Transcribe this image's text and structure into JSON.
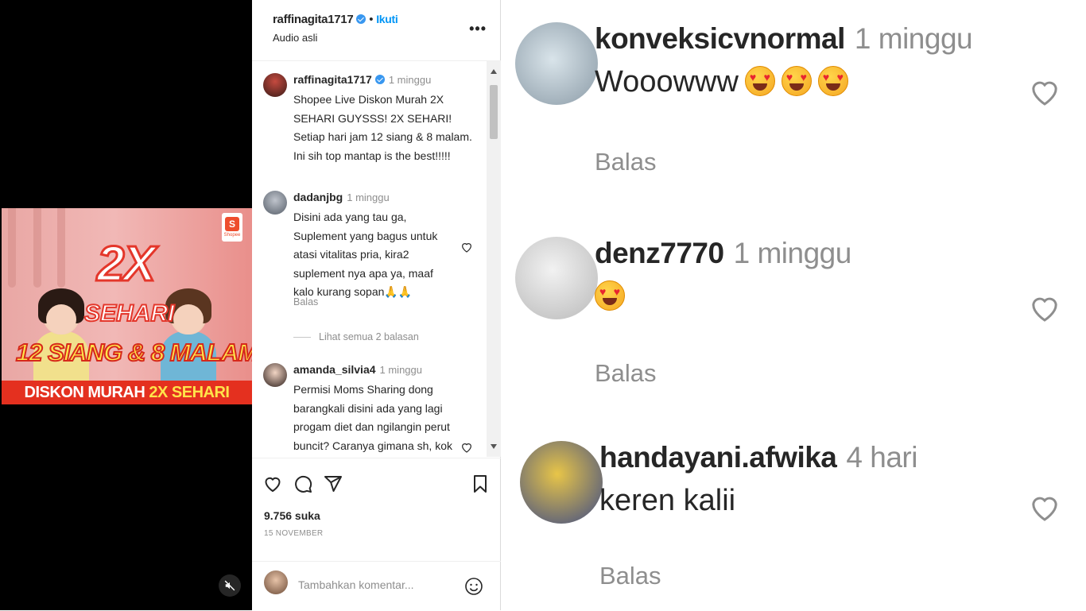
{
  "post": {
    "author": "raffinagita1717",
    "follow_label": "Ikuti",
    "audio_label": "Audio asli",
    "more_icon": "more-options-icon"
  },
  "video": {
    "thumbnail_text": {
      "main": "2X",
      "sub": "SEHARI",
      "times": "12 SIANG & 8 MALAM",
      "banner_prefix": "DISKON MURAH",
      "banner_highlight": "2X SEHARI",
      "brand_letter": "S",
      "brand_name": "Shopee"
    },
    "mute_icon": "muted-speaker-icon"
  },
  "caption": {
    "user": "raffinagita1717",
    "time": "1 minggu",
    "text": "Shopee Live Diskon Murah 2X SEHARI GUYSSS! 2X SEHARI! Setiap hari jam 12 siang & 8 malam. Ini sih top mantap is the best!!!!!"
  },
  "comments": [
    {
      "user": "dadanjbg",
      "time": "1 minggu",
      "text": "Disini ada yang tau ga, Suplement yang bagus untuk atasi vitalitas pria, kira2 suplement nya apa ya, maaf kalo kurang sopan🙏🙏",
      "reply_label": "Balas",
      "view_replies": "Lihat semua 2 balasan"
    },
    {
      "user": "amanda_silvia4",
      "time": "1 minggu",
      "text": "Permisi Moms Sharing dong barangkali disini ada yang lagi progam diet dan ngilangin perut buncit? Caranya gimana sh, kok"
    }
  ],
  "actions": {
    "likes": "9.756 suka",
    "date": "15 NOVEMBER",
    "comment_placeholder": "Tambahkan komentar..."
  },
  "zoomed_comments": [
    {
      "user": "konveksicvnormal",
      "time": "1 minggu",
      "text": "Wooowww",
      "emoji_count": 3,
      "reply_label": "Balas"
    },
    {
      "user": "denz7770",
      "time": "1 minggu",
      "text": "",
      "emoji_count": 1,
      "reply_label": "Balas"
    },
    {
      "user": "handayani.afwika",
      "time": "4 hari",
      "text": "keren kalii",
      "emoji_count": 0,
      "reply_label": "Balas"
    }
  ],
  "colors": {
    "link_blue": "#0095f6",
    "text_primary": "#262626",
    "text_secondary": "#8e8e8e",
    "verified": "#3897f0",
    "shopee_orange": "#ee4d2d"
  }
}
